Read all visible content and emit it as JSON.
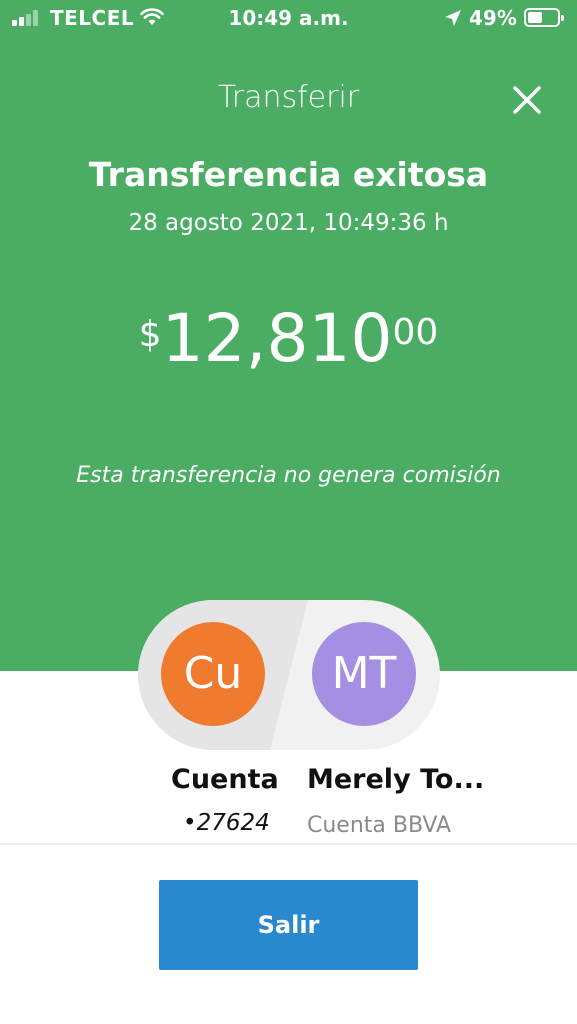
{
  "status_bar": {
    "carrier": "TELCEL",
    "time": "10:49 a.m.",
    "battery_percent": "49%",
    "battery_level": 0.49,
    "signal_bars": 2,
    "icons": [
      "signal-icon",
      "wifi-icon",
      "location-arrow-icon",
      "battery-icon"
    ]
  },
  "header": {
    "title": "Transferir",
    "close_icon": "close-icon"
  },
  "result": {
    "title": "Transferencia exitosa",
    "datetime": "28 agosto 2021, 10:49:36 h"
  },
  "amount": {
    "currency": "$",
    "integer": "12,810",
    "decimals": "00"
  },
  "commission_note": "Esta transferencia no genera comisión",
  "from_account": {
    "initials": "Cu",
    "name": "Cuenta",
    "number": "•27624",
    "color": "#f07b2e"
  },
  "to_account": {
    "initials": "MT",
    "name": "Merely To...",
    "bank": "Cuenta BBVA",
    "color": "#a48fe2"
  },
  "actions": {
    "exit_label": "Salir"
  },
  "colors": {
    "header_green": "#4aad63",
    "button_blue": "#2a88cf"
  }
}
